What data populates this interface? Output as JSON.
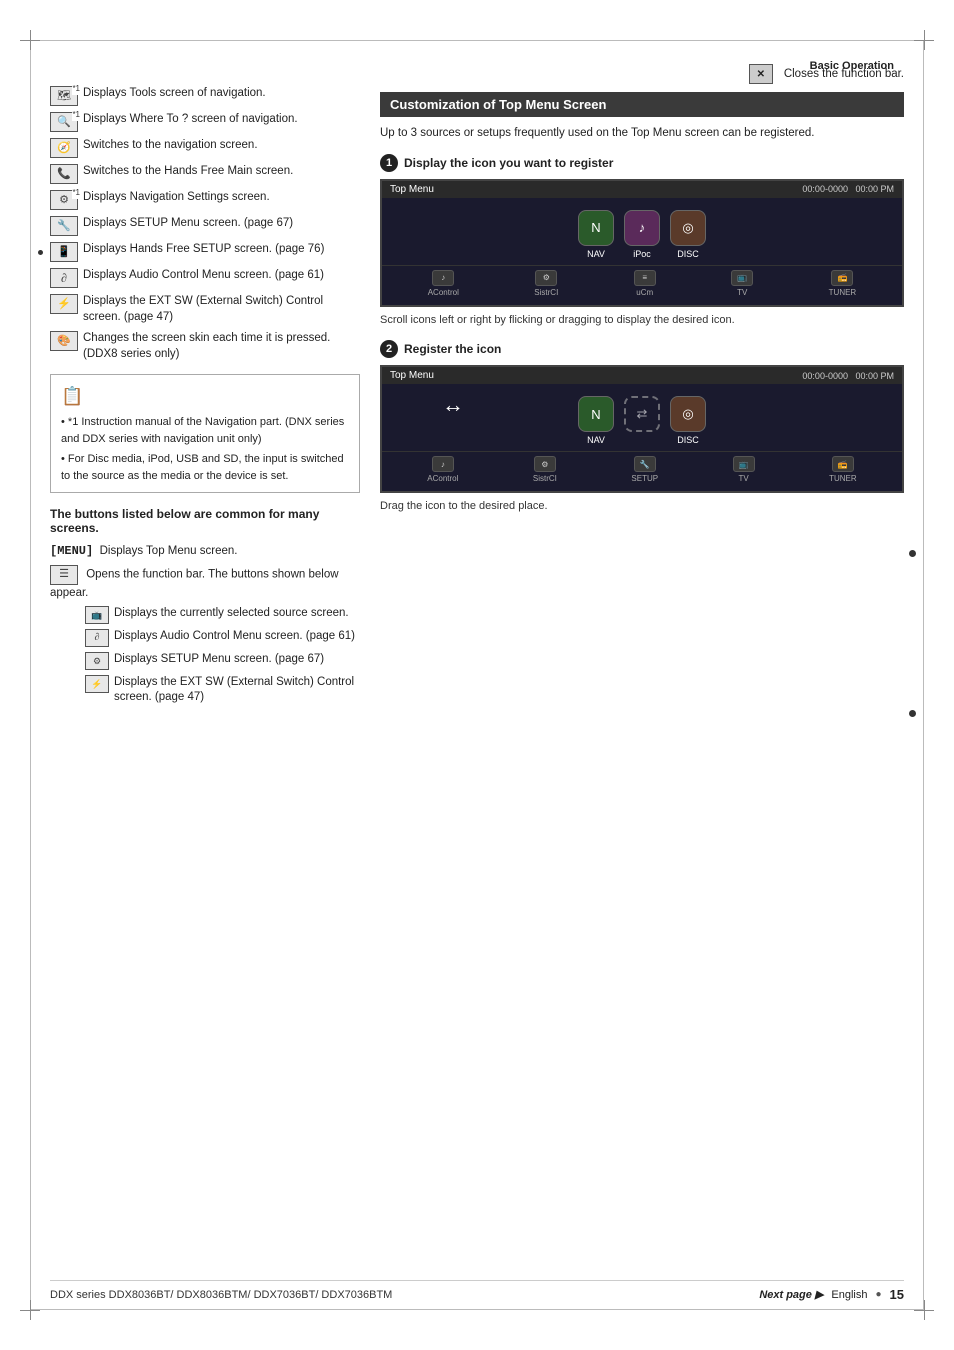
{
  "page": {
    "header": "Basic Operation",
    "footer": {
      "series": "DDX series  DDX8036BT/ DDX8036BTM/ DDX7036BT/ DDX7036BTM",
      "next_page": "Next page ▶",
      "language": "English",
      "page_number": "15"
    }
  },
  "left_column": {
    "icon_items": [
      {
        "id": "tools-nav",
        "icon_label": "🗺",
        "asterisk": "*1",
        "text": "Displays Tools screen of navigation."
      },
      {
        "id": "where-to",
        "icon_label": "🔍",
        "asterisk": "*1",
        "text": "Displays Where To ? screen of navigation."
      },
      {
        "id": "nav-screen",
        "icon_label": "🧭",
        "asterisk": "",
        "text": "Switches to the navigation screen."
      },
      {
        "id": "hands-free-main",
        "icon_label": "📞",
        "asterisk": "",
        "text": "Switches to the Hands Free Main screen."
      },
      {
        "id": "nav-settings",
        "icon_label": "⚙",
        "asterisk": "*1",
        "text": "Displays Navigation Settings screen."
      },
      {
        "id": "setup-menu",
        "icon_label": "🔧",
        "asterisk": "",
        "text": "Displays SETUP Menu screen. (page 67)"
      },
      {
        "id": "hands-free-setup",
        "icon_label": "📱",
        "asterisk": "",
        "text": "Displays Hands Free SETUP screen. (page 76)"
      },
      {
        "id": "audio-control",
        "icon_label": "🎵",
        "asterisk": "",
        "text": "Displays Audio Control Menu screen. (page 61)"
      },
      {
        "id": "ext-sw",
        "icon_label": "🔌",
        "asterisk": "",
        "text": "Displays the EXT SW (External Switch) Control screen. (page 47)"
      },
      {
        "id": "screen-skin",
        "icon_label": "🎨",
        "asterisk": "",
        "text": "Changes the screen skin each time it is pressed. (DDX8 series only)"
      }
    ],
    "note": {
      "items": [
        "*1 Instruction manual of the Navigation part. (DNX series and DDX series with navigation unit only)",
        "• For Disc media, iPod, USB and SD, the input is switched to the source as the media or the device is set."
      ]
    },
    "common_section": {
      "title": "The buttons listed below are common for many screens.",
      "items": [
        {
          "id": "menu-btn",
          "label": "[MENU]",
          "text": "Displays Top Menu screen."
        },
        {
          "id": "function-bar",
          "icon_label": "☰",
          "text": "Opens the function bar. The buttons shown below appear.",
          "sub_items": [
            {
              "id": "current-source",
              "icon_label": "📺",
              "text": "Displays the currently selected source screen."
            },
            {
              "id": "audio-control-sub",
              "icon_label": "🎵",
              "text": "Displays Audio Control Menu screen. (page 61)"
            },
            {
              "id": "setup-menu-sub",
              "icon_label": "⚙",
              "text": "Displays SETUP Menu screen. (page 67)"
            },
            {
              "id": "ext-sw-sub",
              "icon_label": "🔌",
              "text": "Displays the EXT SW (External Switch) Control screen. (page 47)"
            }
          ]
        },
        {
          "id": "close-bar",
          "icon_label": "✕",
          "text": "Closes the function bar."
        }
      ]
    }
  },
  "right_column": {
    "customization": {
      "header": "Customization of Top Menu Screen",
      "description": "Up to 3 sources or setups frequently used on the Top Menu screen can be registered.",
      "steps": [
        {
          "num": "1",
          "title": "Display the icon you want to register",
          "screen": {
            "title": "Top Menu",
            "time": "00:00-0000 00:00 PM",
            "icons": [
              {
                "label": "NAV",
                "type": "nav"
              },
              {
                "label": "iPoc",
                "type": "ipod"
              },
              {
                "label": "DISC",
                "type": "disc"
              }
            ],
            "bottom_buttons": [
              "AControl",
              "SistrCI",
              "uCm",
              "TV",
              "TUNER"
            ]
          },
          "caption": "Scroll icons left or right by flicking or dragging to display the desired icon."
        },
        {
          "num": "2",
          "title": "Register the icon",
          "screen": {
            "title": "Top Menu",
            "time": "00:00-0000 00:00 PM",
            "icons": [
              {
                "label": "NAV",
                "type": "nav"
              },
              {
                "label": "↔",
                "type": "arrow"
              },
              {
                "label": "DISC",
                "type": "disc"
              }
            ],
            "bottom_buttons": [
              "AControl",
              "SistrCI",
              "SETUP",
              "TV",
              "TUNER"
            ]
          },
          "caption": "Drag the icon to the desired place."
        }
      ]
    }
  }
}
